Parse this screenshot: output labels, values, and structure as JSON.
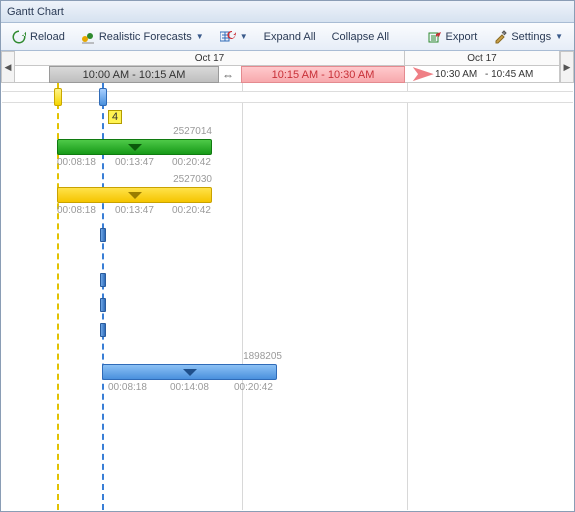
{
  "window": {
    "title": "Gantt Chart"
  },
  "toolbar": {
    "reload": "Reload",
    "forecasts": "Realistic Forecasts",
    "expand": "Expand All",
    "collapse": "Collapse All",
    "export": "Export",
    "settings": "Settings"
  },
  "header": {
    "date_left": "Oct 17",
    "date_right": "Oct 17",
    "slot_gray": "10:00 AM - 10:15 AM",
    "slot_red": "10:15 AM - 10:30 AM",
    "slot_plain_a": "10:30 AM",
    "slot_plain_b": "- 10:45 AM"
  },
  "badge": {
    "count": "4"
  },
  "tasks": {
    "t1": {
      "id": "2527014",
      "a": "00:08:18",
      "b": "00:13:47",
      "c": "00:20:42"
    },
    "t2": {
      "id": "2527030",
      "a": "00:08:18",
      "b": "00:13:47",
      "c": "00:20:42"
    },
    "t3": {
      "id": "1898205",
      "a": "00:08:18",
      "b": "00:14:08",
      "c": "00:20:42"
    }
  },
  "chart_data": {
    "type": "gantt",
    "title": "Gantt Chart",
    "date": "Oct 17",
    "time_slots": [
      "10:00 AM - 10:15 AM",
      "10:15 AM - 10:30 AM",
      "10:30 AM - 10:45 AM"
    ],
    "current_slot": "10:00 AM - 10:15 AM",
    "highlighted_slot": "10:15 AM - 10:30 AM",
    "badge_count": 4,
    "vertical_markers": [
      {
        "kind": "yellow",
        "approx_time": "10:00"
      },
      {
        "kind": "blue",
        "approx_time": "10:03"
      }
    ],
    "rows": [
      {
        "id": "2527014",
        "color": "green",
        "ticks": [
          "00:08:18",
          "00:13:47",
          "00:20:42"
        ]
      },
      {
        "id": "2527030",
        "color": "yellow",
        "ticks": [
          "00:08:18",
          "00:13:47",
          "00:20:42"
        ]
      },
      {
        "id": "1898205",
        "color": "blue",
        "ticks": [
          "00:08:18",
          "00:14:08",
          "00:20:42"
        ]
      }
    ],
    "extra_blue_ticks_at_rows": 4
  }
}
